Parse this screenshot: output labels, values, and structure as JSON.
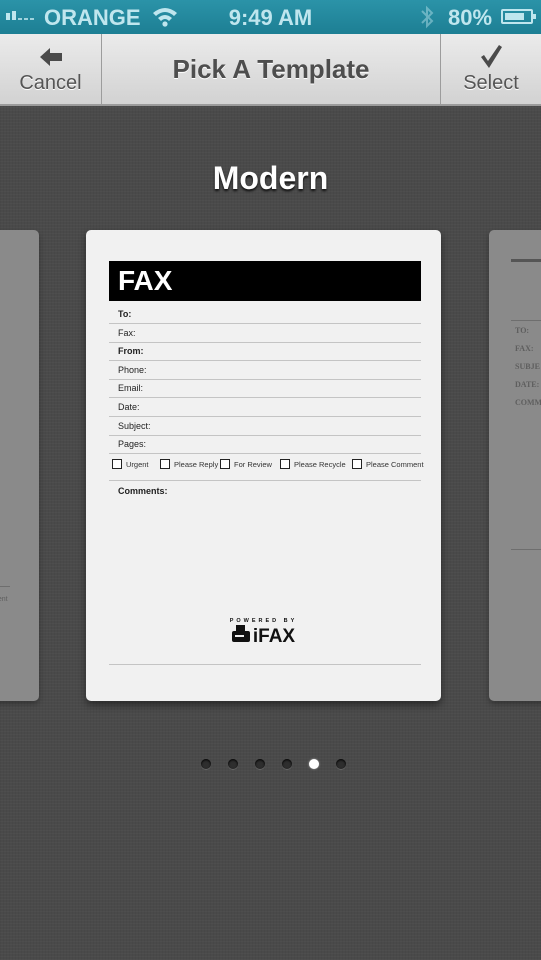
{
  "status_bar": {
    "carrier": "ORANGE",
    "time": "9:49 AM",
    "battery_percent": "80%",
    "battery_level": 0.8,
    "signal_bars": 2,
    "icons": [
      "signal-icon",
      "wifi-icon",
      "bluetooth-icon",
      "battery-icon"
    ]
  },
  "nav": {
    "title": "Pick A Template",
    "cancel_label": "Cancel",
    "select_label": "Select",
    "cancel_icon": "arrow-left-icon",
    "select_icon": "checkmark-icon"
  },
  "template": {
    "name": "Modern",
    "header": "FAX",
    "fields": [
      {
        "label": "To:",
        "bold": true
      },
      {
        "label": "Fax:",
        "bold": false
      },
      {
        "label": "From:",
        "bold": true
      },
      {
        "label": "Phone:",
        "bold": false
      },
      {
        "label": "Email:",
        "bold": false
      },
      {
        "label": "Date:",
        "bold": false
      },
      {
        "label": "Subject:",
        "bold": false
      },
      {
        "label": "Pages:",
        "bold": false
      }
    ],
    "checkboxes": [
      "Urgent",
      "Please Reply",
      "For Review",
      "Please Recycle",
      "Please Comment"
    ],
    "comments_label": "Comments:",
    "powered_by": "POWERED BY",
    "brand": "iFAX"
  },
  "prev_template": {
    "partial_text": "ment"
  },
  "next_template": {
    "fields": [
      "TO:",
      "FAX:",
      "SUBJE",
      "DATE:",
      "COMM"
    ]
  },
  "pager": {
    "total": 6,
    "current_index": 4
  }
}
